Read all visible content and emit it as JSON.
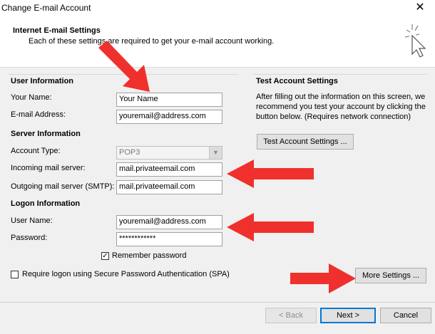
{
  "window": {
    "title": "Change E-mail Account",
    "close_glyph": "✕"
  },
  "header": {
    "title": "Internet E-mail Settings",
    "subtitle": "Each of these settings are required to get your e-mail account working."
  },
  "user_info": {
    "heading": "User Information",
    "name_label": "Your Name:",
    "name_value": "Your Name",
    "email_label": "E-mail Address:",
    "email_value": "youremail@address.com"
  },
  "server_info": {
    "heading": "Server Information",
    "account_type_label": "Account Type:",
    "account_type_value": "POP3",
    "incoming_label": "Incoming mail server:",
    "incoming_value": "mail.privateemail.com",
    "outgoing_label": "Outgoing mail server (SMTP):",
    "outgoing_value": "mail.privateemail.com"
  },
  "logon_info": {
    "heading": "Logon Information",
    "username_label": "User Name:",
    "username_value": "youremail@address.com",
    "password_label": "Password:",
    "password_value": "************",
    "remember_label": "Remember password",
    "remember_checked": true,
    "spa_label": "Require logon using Secure Password Authentication (SPA)",
    "spa_checked": false
  },
  "test_settings": {
    "heading": "Test Account Settings",
    "description_line1": "After filling out the information on this screen, we",
    "description_line2": "recommend you test your account by clicking the",
    "description_line3": "button below. (Requires network connection)",
    "test_button": "Test Account Settings ..."
  },
  "more_settings_button": "More Settings ...",
  "footer": {
    "back_button": "< Back",
    "next_button": "Next >",
    "cancel_button": "Cancel"
  },
  "colors": {
    "annotation_arrow": "#f0302d",
    "focus_blue": "#0078d7"
  },
  "icons": {
    "wizard": "cursor-sparkle-icon",
    "close": "close-icon",
    "dropdown": "chevron-down-icon",
    "check": "checkmark-icon"
  }
}
